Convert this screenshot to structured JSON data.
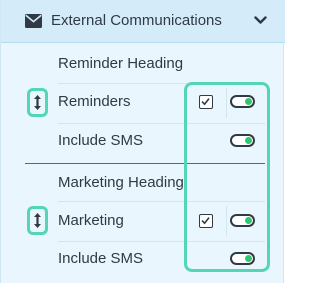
{
  "header": {
    "title": "External Communications",
    "icon": "envelope-icon",
    "collapse_icon": "chevron-down-icon"
  },
  "groups": [
    {
      "heading": "Reminder Heading",
      "item_label": "Reminders",
      "item_checked": true,
      "item_enabled": true,
      "sms_label": "Include SMS",
      "sms_enabled": true
    },
    {
      "heading": "Marketing Heading",
      "item_label": "Marketing",
      "item_checked": true,
      "item_enabled": true,
      "sms_label": "Include SMS",
      "sms_enabled": true
    }
  ],
  "colors": {
    "highlight": "#52d6b7",
    "toggle_on": "#32c46e",
    "header_bg": "#d4ecfa",
    "panel_bg": "#eaf6fd"
  }
}
